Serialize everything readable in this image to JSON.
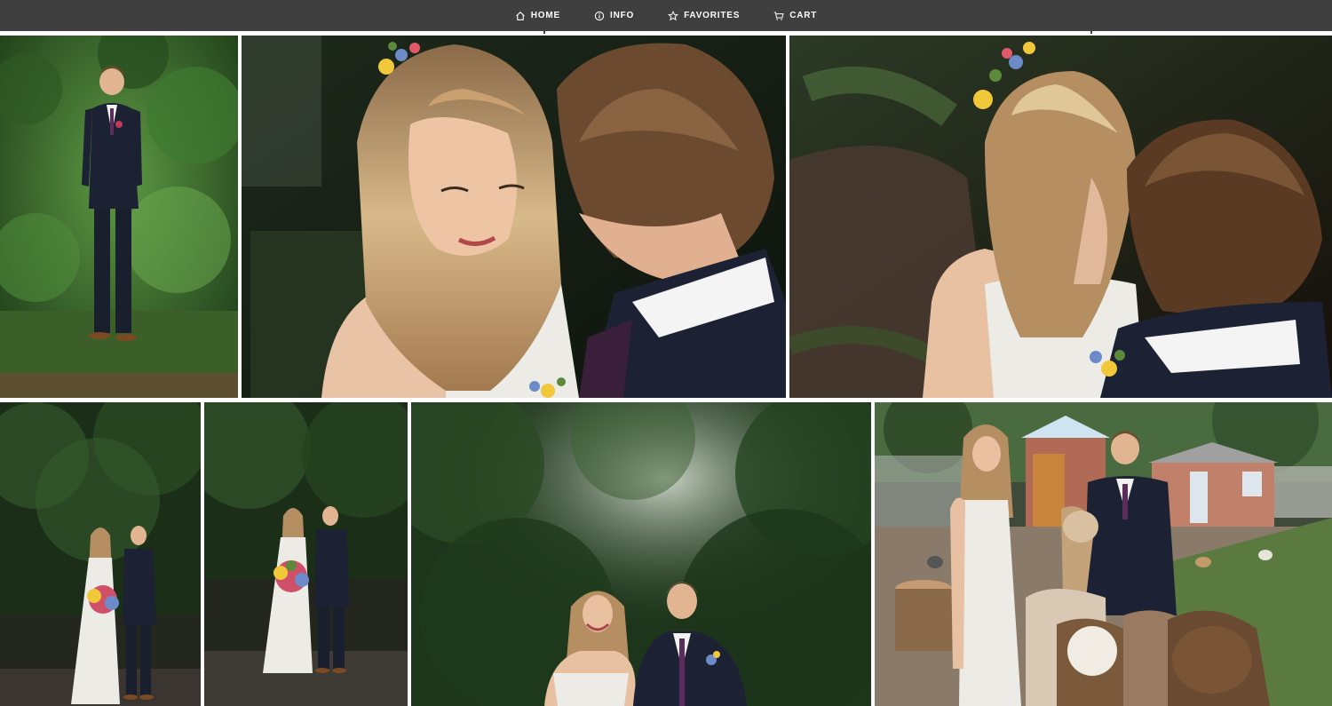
{
  "nav": {
    "items": [
      {
        "label": "HOME",
        "icon": "home-icon"
      },
      {
        "label": "INFO",
        "icon": "info-icon"
      },
      {
        "label": "FAVORITES",
        "icon": "star-icon"
      },
      {
        "label": "CART",
        "icon": "cart-icon"
      }
    ]
  },
  "colors": {
    "topbar": "#3f3f3f",
    "foliage_dark": "#1f3a1c",
    "foliage_light": "#4f8a3a",
    "suit": "#1c2233",
    "dress": "#efede8",
    "hair_blonde": "#b08a5c",
    "hair_brown": "#5a3a22"
  },
  "gallery": {
    "photos": [
      {
        "name": "photo-groom-standing-in-garden"
      },
      {
        "name": "photo-couple-closeup-foreheads"
      },
      {
        "name": "photo-couple-overhead-closeup"
      },
      {
        "name": "photo-couple-under-trees-wide"
      },
      {
        "name": "photo-couple-holding-bouquet"
      },
      {
        "name": "photo-couple-laughing-forest"
      },
      {
        "name": "photo-couple-with-alpacas"
      }
    ]
  }
}
